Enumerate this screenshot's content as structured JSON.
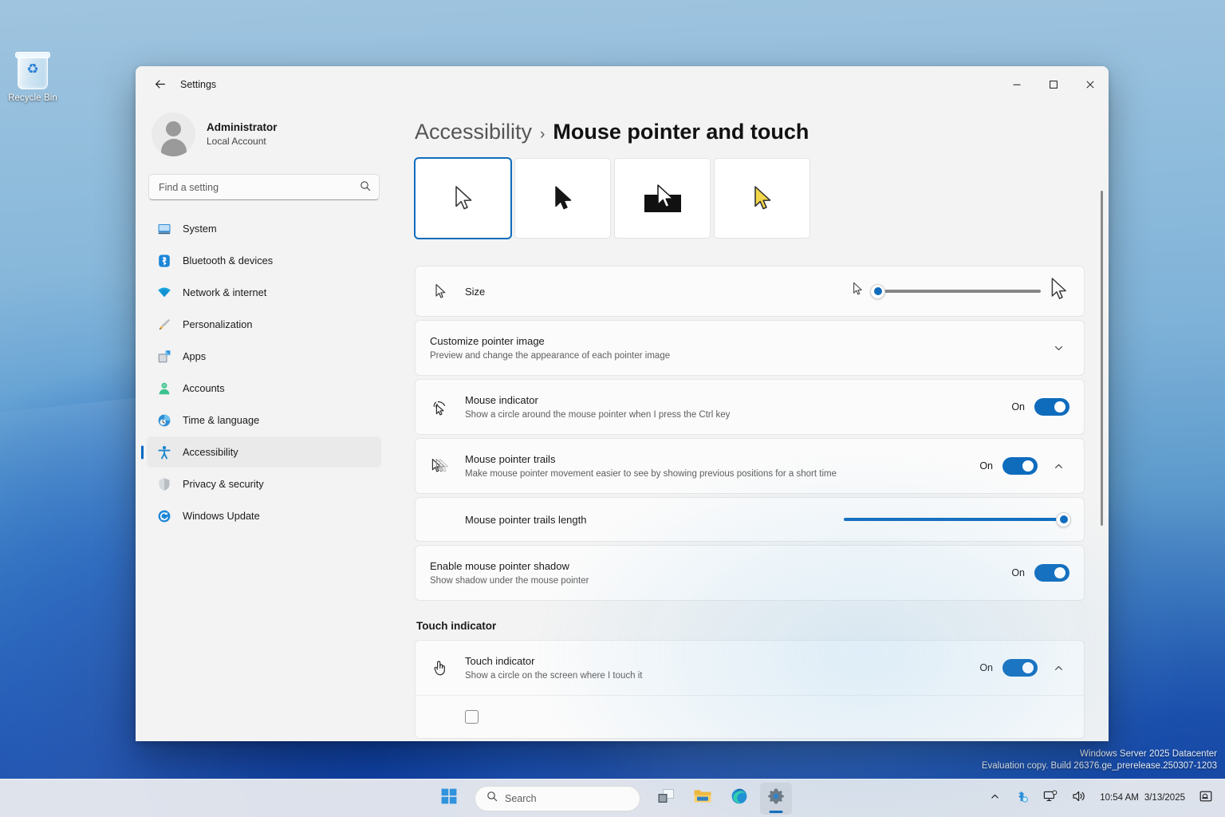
{
  "desktop": {
    "recycle_bin_label": "Recycle Bin",
    "recycle_icon": "recycle-bin-icon",
    "watermark_line1": "Windows Server 2025 Datacenter",
    "watermark_line2": "Evaluation copy. Build 26376.ge_prerelease.250307-1203"
  },
  "window": {
    "app_title": "Settings",
    "back_icon": "back-arrow-icon",
    "minimize": "—",
    "maximize": "☐",
    "close": "✕"
  },
  "sidebar": {
    "account_name": "Administrator",
    "account_type": "Local Account",
    "search_placeholder": "Find a setting",
    "search_value": "",
    "search_icon": "search-icon",
    "items": [
      {
        "label": "System",
        "icon": "system-icon",
        "active": false
      },
      {
        "label": "Bluetooth & devices",
        "icon": "bluetooth-icon",
        "active": false
      },
      {
        "label": "Network & internet",
        "icon": "network-icon",
        "active": false
      },
      {
        "label": "Personalization",
        "icon": "brush-icon",
        "active": false
      },
      {
        "label": "Apps",
        "icon": "apps-icon",
        "active": false
      },
      {
        "label": "Accounts",
        "icon": "accounts-icon",
        "active": false
      },
      {
        "label": "Time & language",
        "icon": "clock-icon",
        "active": false
      },
      {
        "label": "Accessibility",
        "icon": "accessibility-icon",
        "active": true
      },
      {
        "label": "Privacy & security",
        "icon": "shield-icon",
        "active": false
      },
      {
        "label": "Windows Update",
        "icon": "update-icon",
        "active": false
      }
    ]
  },
  "main": {
    "breadcrumb_parent": "Accessibility",
    "breadcrumb_separator": "›",
    "breadcrumb_current": "Mouse pointer and touch",
    "pointer_styles": [
      {
        "name": "white",
        "selected": true
      },
      {
        "name": "black",
        "selected": false
      },
      {
        "name": "inverted",
        "selected": false
      },
      {
        "name": "custom-yellow",
        "selected": false
      }
    ],
    "size_row": {
      "label": "Size",
      "icon": "pointer-icon",
      "min_icon": "small-pointer-icon",
      "max_icon": "large-pointer-icon",
      "value": 1,
      "min": 1,
      "max": 15
    },
    "customize_pointer": {
      "title": "Customize pointer image",
      "subtitle": "Preview and change the appearance of each pointer image",
      "chevron": "∨"
    },
    "mouse_indicator": {
      "title": "Mouse indicator",
      "subtitle": "Show a circle around the mouse pointer when I press the Ctrl key",
      "icon": "mouse-indicator-icon",
      "state": "On",
      "enabled": true
    },
    "mouse_pointer_trails": {
      "title": "Mouse pointer trails",
      "subtitle": "Make mouse pointer movement easier to see by showing previous positions for a short time",
      "icon": "pointer-trails-icon",
      "state": "On",
      "enabled": true,
      "chevron": "∧"
    },
    "trails_length": {
      "label": "Mouse pointer trails length",
      "value": 100,
      "min": 0,
      "max": 100
    },
    "pointer_shadow": {
      "title": "Enable mouse pointer shadow",
      "subtitle": "Show shadow under the mouse pointer",
      "state": "On",
      "enabled": true
    },
    "touch_section_header": "Touch indicator",
    "touch_indicator": {
      "title": "Touch indicator",
      "subtitle": "Show a circle on the screen where I touch it",
      "icon": "touch-icon",
      "state": "On",
      "enabled": true,
      "chevron": "∧"
    }
  },
  "taskbar": {
    "start_icon": "windows-start-icon",
    "search_placeholder": "Search",
    "search_icon": "search-icon",
    "buttons": [
      {
        "name": "task-view-icon"
      },
      {
        "name": "file-explorer-icon"
      },
      {
        "name": "edge-browser-icon"
      },
      {
        "name": "settings-icon"
      }
    ],
    "tray": {
      "chevron_icon": "show-hidden-icons-chevron",
      "bluetooth_icon": "bluetooth-tray-icon",
      "network_icon": "network-tray-icon",
      "volume_icon": "volume-tray-icon",
      "notification_icon": "notification-bell-icon",
      "time": "10:54 AM",
      "date": "3/13/2025"
    }
  },
  "colors": {
    "accent": "#0f6cbd",
    "selected_border": "#0f6cbd",
    "window_bg": "#f3f3f3",
    "card_bg": "#fbfbfb"
  }
}
